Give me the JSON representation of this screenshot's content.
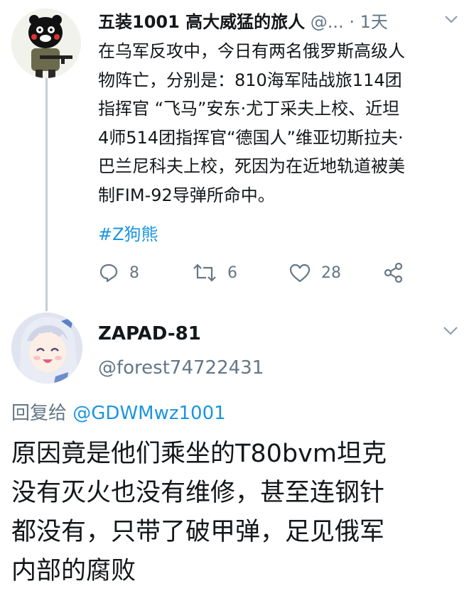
{
  "tweet1": {
    "name": "五装1001 高大威猛的旅人",
    "meta": "@... · 1天",
    "body_lines": [
      "在乌军反攻中，今日有两名俄罗斯高级人",
      "物阵亡，分别是：810海军陆战旅114团",
      "指挥官 “飞马”安东·尤丁采夫上校、近坦",
      "4师514团指挥官“德国人”维亚切斯拉夫·",
      "巴兰尼科夫上校，死因为在近地轨道被美",
      "制FIM-92导弹所命中。"
    ],
    "hashtag": "#Z狗熊",
    "replies": "8",
    "retweets": "6",
    "likes": "28"
  },
  "tweet2": {
    "name": "ZAPAD-81",
    "handle": "@forest74722431",
    "reply_prefix": "回复给",
    "reply_to": "@GDWMwz1001",
    "body_lines": [
      "原因竟是他们乘坐的T80bvm坦克",
      "没有灭火也没有维修，甚至连钢针",
      "都没有，只带了破甲弹，足见俄军",
      "内部的腐败"
    ]
  },
  "colors": {
    "link": "#1b95e0",
    "muted": "#657786",
    "text": "#14171a",
    "thread_line": "#c4cfd6"
  }
}
